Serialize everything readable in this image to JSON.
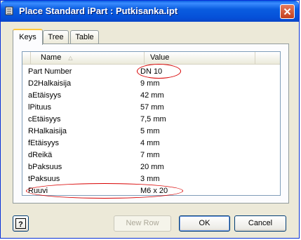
{
  "window": {
    "title": "Place Standard iPart : Putkisanka.ipt"
  },
  "tabs": [
    {
      "label": "Keys"
    },
    {
      "label": "Tree"
    },
    {
      "label": "Table"
    }
  ],
  "table": {
    "columns": {
      "name": "Name",
      "value": "Value"
    },
    "rows": [
      {
        "name": "Part Number",
        "value": "DN 10"
      },
      {
        "name": "D2Halkaisija",
        "value": "9 mm"
      },
      {
        "name": "aEtäisyys",
        "value": "42 mm"
      },
      {
        "name": "lPituus",
        "value": "57 mm"
      },
      {
        "name": "cEtäisyys",
        "value": "7,5 mm"
      },
      {
        "name": "RHalkaisija",
        "value": "5 mm"
      },
      {
        "name": "fEtäisyys",
        "value": "4 mm"
      },
      {
        "name": "dReikä",
        "value": "7 mm"
      },
      {
        "name": "bPaksuus",
        "value": "20 mm"
      },
      {
        "name": "tPaksuus",
        "value": "3 mm"
      },
      {
        "name": "Ruuvi",
        "value": "M6 x 20"
      }
    ]
  },
  "buttons": {
    "help": "?",
    "new_row": "New Row",
    "ok": "OK",
    "cancel": "Cancel"
  },
  "icons": {
    "window": "ipart-icon",
    "close": "close-icon",
    "help": "help-icon",
    "sort": "sort-ascending-icon"
  },
  "colors": {
    "titlebar": "#0a5de0",
    "annotation": "#d80000",
    "tab_highlight": "#ffc83c"
  }
}
